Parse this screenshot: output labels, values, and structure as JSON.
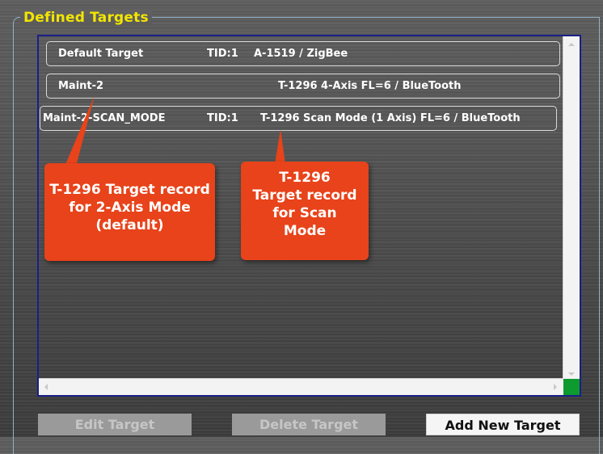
{
  "group": {
    "title": "Defined Targets"
  },
  "targets": [
    {
      "name": "Default Target",
      "tid": "TID:1",
      "desc": "A-1519 / ZigBee"
    },
    {
      "name": "Maint-2",
      "tid": "",
      "desc": "T-1296 4-Axis FL=6 / BlueTooth"
    },
    {
      "name": "Maint-2-SCAN_MODE",
      "tid": "TID:1",
      "desc": "T-1296 Scan Mode (1 Axis) FL=6 / BlueTooth"
    }
  ],
  "callouts": [
    {
      "text": "T-1296 Target record for 2-Axis Mode (default)"
    },
    {
      "text": "T-1296 Target record for Scan Mode"
    }
  ],
  "buttons": {
    "edit": "Edit Target",
    "delete": "Delete Target",
    "add": "Add New Target"
  },
  "colors": {
    "group_title": "#f2e600",
    "list_border": "#1a1f88",
    "callout": "#e8431a",
    "scroll_corner": "#0d9a2e"
  }
}
